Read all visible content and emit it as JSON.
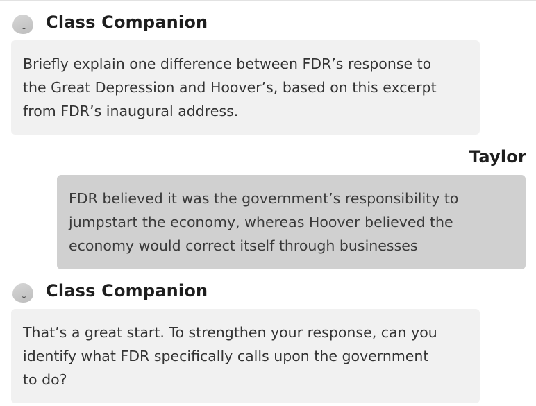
{
  "conversation": {
    "messages": [
      {
        "sender": "Class Companion",
        "avatar_icon": "companion-avatar-icon",
        "text": "Briefly explain one difference between FDR’s response to\nthe Great Depression and Hoover’s, based on this excerpt\nfrom FDR’s inaugural address."
      },
      {
        "sender": "Taylor",
        "text": "FDR believed it was the government’s responsibility to\njumpstart the economy, whereas Hoover believed the\neconomy would correct itself through businesses"
      },
      {
        "sender": "Class Companion",
        "avatar_icon": "companion-avatar-icon",
        "text": "That’s a great start. To strengthen your response, can you\nidentify what FDR specifically calls upon the government\nto do?"
      }
    ]
  },
  "colors": {
    "bot_bubble": "#f1f1f1",
    "user_bubble": "#d0d0d0",
    "text": "#333333",
    "sender_name": "#1e1e1e"
  }
}
